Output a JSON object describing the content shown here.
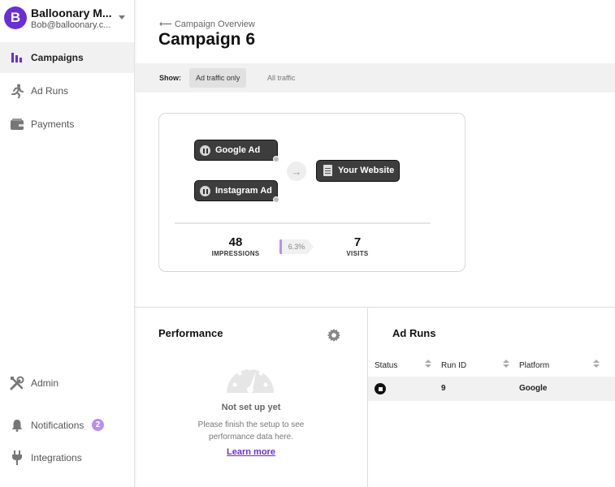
{
  "account": {
    "logo_letter": "B",
    "name": "Balloonary M...",
    "email": "Bob@balloonary.c..."
  },
  "nav": {
    "campaigns": "Campaigns",
    "ad_runs": "Ad Runs",
    "payments": "Payments",
    "admin": "Admin",
    "notifications": "Notifications",
    "notifications_count": "2",
    "integrations": "Integrations"
  },
  "header": {
    "back_label": "⟵ Campaign Overview",
    "title": "Campaign 6"
  },
  "filter": {
    "show_label": "Show:",
    "options": [
      "Ad traffic only",
      "All traffic"
    ],
    "selected": "Ad traffic only"
  },
  "flow": {
    "sources": [
      "Google Ad",
      "Instagram Ad"
    ],
    "destination": "Your Website",
    "impressions": "48",
    "impressions_label": "IMPRESSIONS",
    "rate": "6.3%",
    "visits": "7",
    "visits_label": "VISITS"
  },
  "performance": {
    "title": "Performance",
    "empty_title": "Not set up yet",
    "empty_desc": "Please finish the setup to see performance data here.",
    "learn_more": "Learn more"
  },
  "ad_runs": {
    "title": "Ad Runs",
    "columns": [
      "Status",
      "Run ID",
      "Platform"
    ],
    "rows": [
      {
        "status": "stopped",
        "run_id": "9",
        "platform": "Google"
      }
    ]
  },
  "colors": {
    "accent": "#6a2fd4",
    "badge": "#b98cf0"
  }
}
